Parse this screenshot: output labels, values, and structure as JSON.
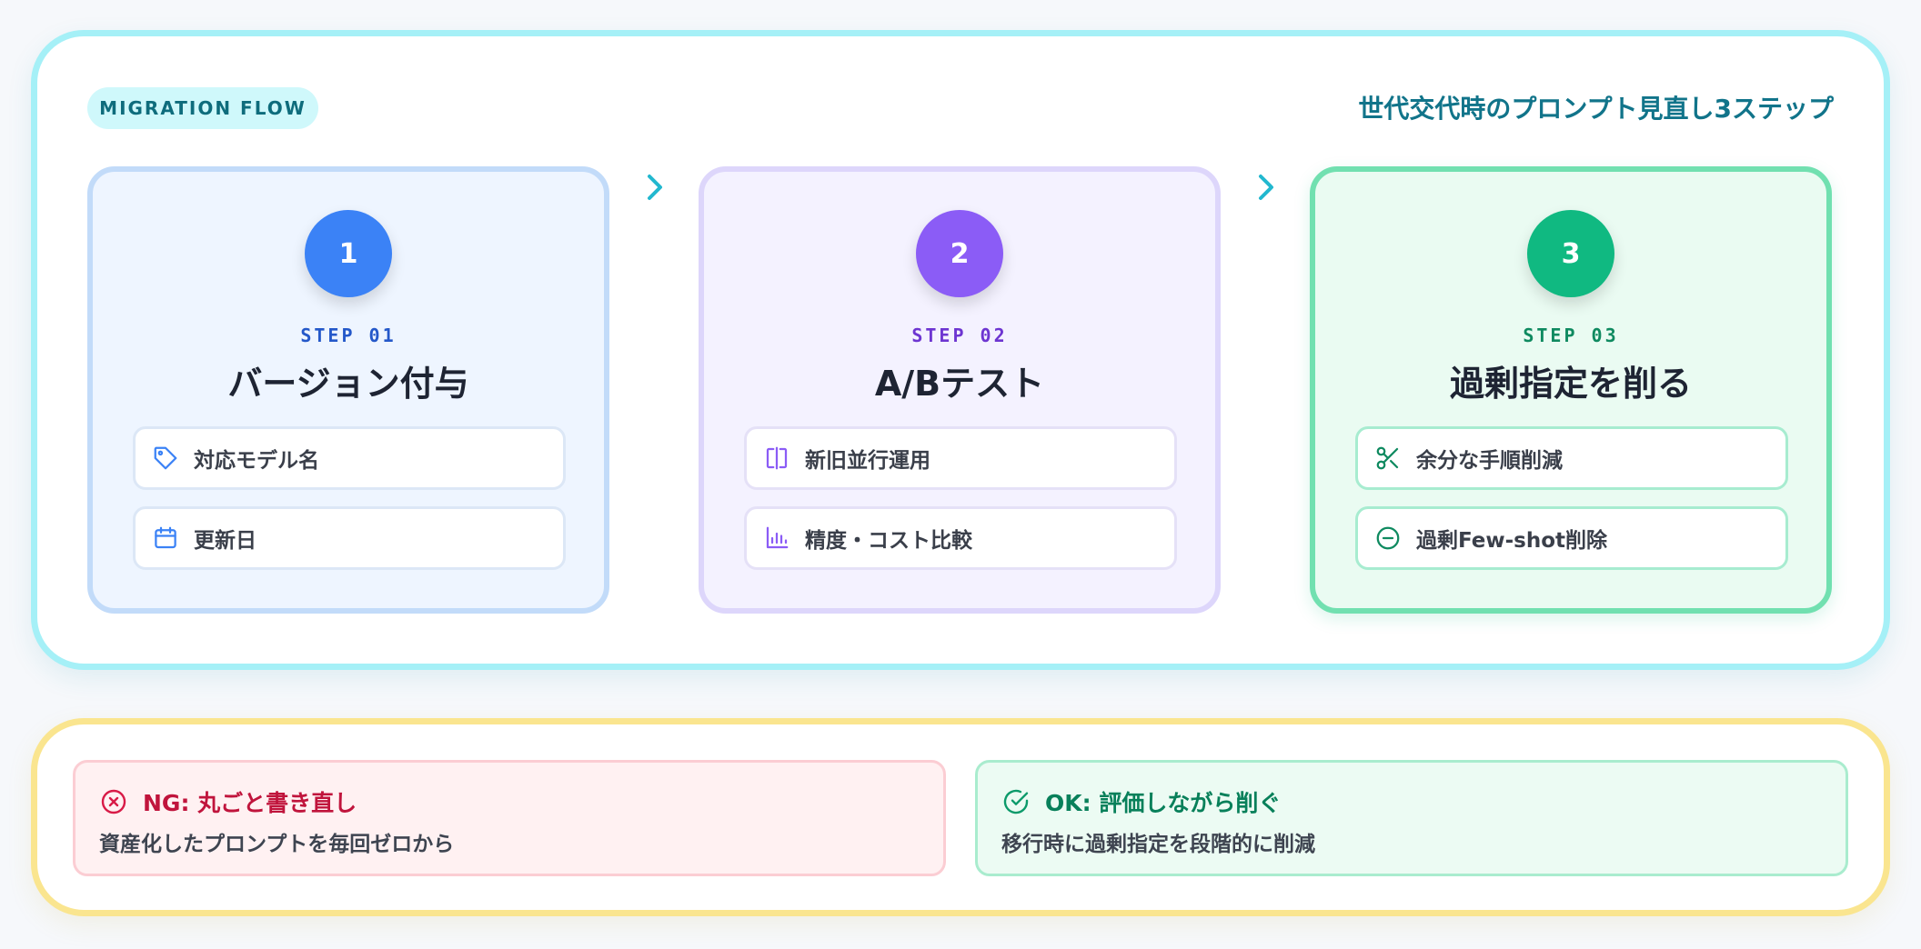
{
  "header": {
    "pill": "MIGRATION FLOW",
    "headline": "世代交代時のプロンプト見直し3ステップ"
  },
  "colors": {
    "accent_cyan": "#22b8cf",
    "step1": "#3b82f6",
    "step2": "#8b5cf6",
    "step3": "#10b981",
    "ng": "#c0143c",
    "ok": "#08805a"
  },
  "steps": [
    {
      "number": "1",
      "label": "STEP 01",
      "title": "バージョン付与",
      "items": [
        {
          "icon": "tag-icon",
          "text": "対応モデル名"
        },
        {
          "icon": "calendar-icon",
          "text": "更新日"
        }
      ]
    },
    {
      "number": "2",
      "label": "STEP 02",
      "title": "A/Bテスト",
      "items": [
        {
          "icon": "split-columns-icon",
          "text": "新旧並行運用"
        },
        {
          "icon": "bar-chart-icon",
          "text": "精度・コスト比較"
        }
      ]
    },
    {
      "number": "3",
      "label": "STEP 03",
      "title": "過剰指定を削る",
      "items": [
        {
          "icon": "scissors-icon",
          "text": "余分な手順削減"
        },
        {
          "icon": "minus-circle-icon",
          "text": "過剰Few-shot削除"
        }
      ]
    }
  ],
  "notes": {
    "ng": {
      "icon": "x-circle-icon",
      "title": "NG: 丸ごと書き直し",
      "body": "資産化したプロンプトを毎回ゼロから"
    },
    "ok": {
      "icon": "check-circle-icon",
      "title": "OK: 評価しながら削ぐ",
      "body": "移行時に過剰指定を段階的に削減"
    }
  }
}
